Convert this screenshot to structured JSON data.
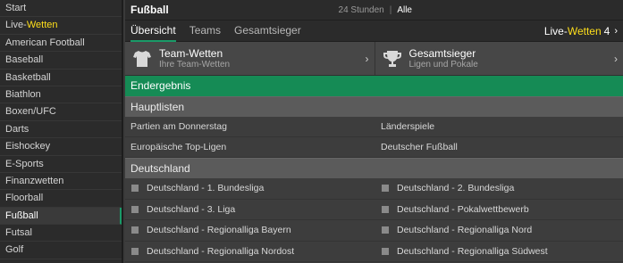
{
  "sidebar": {
    "items": [
      {
        "label": "Start"
      },
      {
        "label_prefix": "Live-",
        "label_highlight": "Wetten"
      },
      {
        "label": "American Football"
      },
      {
        "label": "Baseball"
      },
      {
        "label": "Basketball"
      },
      {
        "label": "Biathlon"
      },
      {
        "label": "Boxen/UFC"
      },
      {
        "label": "Darts"
      },
      {
        "label": "Eishockey"
      },
      {
        "label": "E-Sports"
      },
      {
        "label": "Finanzwetten"
      },
      {
        "label": "Floorball"
      },
      {
        "label": "Fußball"
      },
      {
        "label": "Futsal"
      },
      {
        "label": "Golf"
      }
    ]
  },
  "header": {
    "title": "Fußball",
    "time_filter": {
      "option_1": "24 Stunden",
      "separator": "|",
      "option_2": "Alle"
    }
  },
  "tabs": {
    "items": [
      {
        "label": "Übersicht"
      },
      {
        "label": "Teams"
      },
      {
        "label": "Gesamtsieger"
      }
    ],
    "live": {
      "prefix": "Live-",
      "highlight": "Wetten",
      "count": "4",
      "chevron": "›"
    }
  },
  "features": [
    {
      "title": "Team-Wetten",
      "subtitle": "Ihre Team-Wetten",
      "icon": "jersey-icon",
      "chevron": "›"
    },
    {
      "title": "Gesamtsieger",
      "subtitle": "Ligen und Pokale",
      "icon": "trophy-icon",
      "chevron": "›"
    }
  ],
  "endergebnis": "Endergebnis",
  "hauptlisten": {
    "title": "Hauptlisten",
    "links": [
      "Partien am Donnerstag",
      "Länderspiele",
      "Europäische Top-Ligen",
      "Deutscher Fußball"
    ]
  },
  "deutschland": {
    "title": "Deutschland",
    "leagues": [
      "Deutschland - 1. Bundesliga",
      "Deutschland - 2. Bundesliga",
      "Deutschland - 3. Liga",
      "Deutschland - Pokalwettbewerb",
      "Deutschland - Regionalliga Bayern",
      "Deutschland - Regionalliga Nord",
      "Deutschland - Regionalliga Nordost",
      "Deutschland - Regionalliga Südwest"
    ]
  },
  "colors": {
    "accent_green": "#158b55",
    "highlight_yellow": "#ffdf1b",
    "sidebar_bg": "#2b2b2b",
    "section_header_bg": "#5b5b5b"
  }
}
